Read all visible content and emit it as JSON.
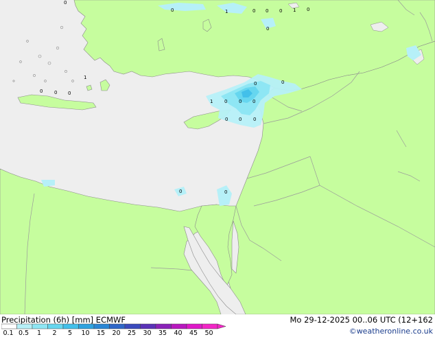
{
  "title": "Precipitation (6h) [mm] ECMWF",
  "datetime": "Mo 29-12-2025 00..06 UTC (12+162",
  "credit": "©weatheronline.co.uk",
  "colors": {
    "sea": "#eeeeee",
    "land": "#c6fd9e",
    "border": "#9a9a9a",
    "coast": "#8a8a8a"
  },
  "legend": {
    "labels": [
      "0.1",
      "0.5",
      "1",
      "2",
      "5",
      "10",
      "15",
      "20",
      "25",
      "30",
      "35",
      "40",
      "45",
      "50"
    ],
    "colors": [
      "#ffffff",
      "#b6f0f8",
      "#8ee6f4",
      "#66d6ef",
      "#43c0ea",
      "#2ea2df",
      "#2a86d4",
      "#2f67c8",
      "#3a4abd",
      "#5a32b7",
      "#8a22b8",
      "#b818bf",
      "#de18c8",
      "#f226c6"
    ]
  },
  "precip_labels": [
    "0",
    "0",
    "1",
    "0",
    "0",
    "0",
    "1",
    "0",
    "0",
    "1",
    "0",
    "0",
    "0",
    "0",
    "0",
    "1",
    "0",
    "0",
    "0",
    "0",
    "0",
    "0"
  ]
}
